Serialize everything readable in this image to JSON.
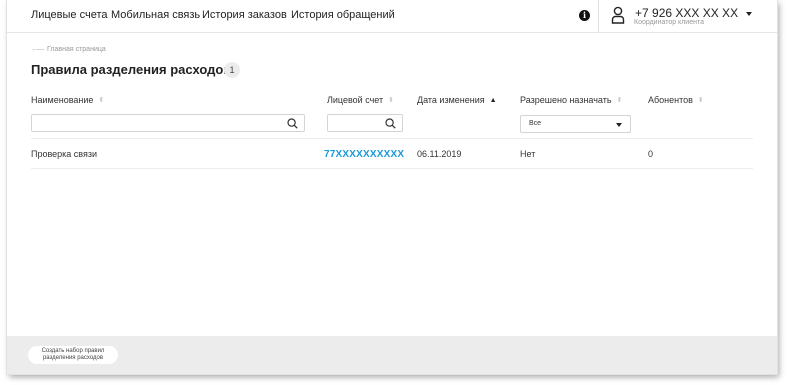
{
  "nav": {
    "items": [
      "Лицевые счета",
      "Мобильная связь",
      "История заказов",
      "История обращений"
    ],
    "phone": "+7 926 XXX XX XX",
    "role": "Координатор клиента"
  },
  "breadcrumb": "Главная страница",
  "page": {
    "title": "Правила разделения расходов",
    "count": "1"
  },
  "table": {
    "columns": [
      "Наименование",
      "Лицевой счет",
      "Дата изменения",
      "Разрешено назначать",
      "Абонентов"
    ],
    "sort_indicator": "⬍",
    "sort_active_indicator": "▲",
    "filters": {
      "name_value": "",
      "account_value": "",
      "allowed_select": "Все"
    },
    "rows": [
      {
        "name": "Проверка связи",
        "account": "77XXXXXXXXXX",
        "date": "06.11.2019",
        "allowed": "Нет",
        "subscribers": "0"
      }
    ]
  },
  "footer": {
    "create_line1": "Создать набор правил",
    "create_line2": "разделения расходов"
  },
  "colors": {
    "link": "#1a9bd7",
    "footer_bg": "#ececec"
  }
}
